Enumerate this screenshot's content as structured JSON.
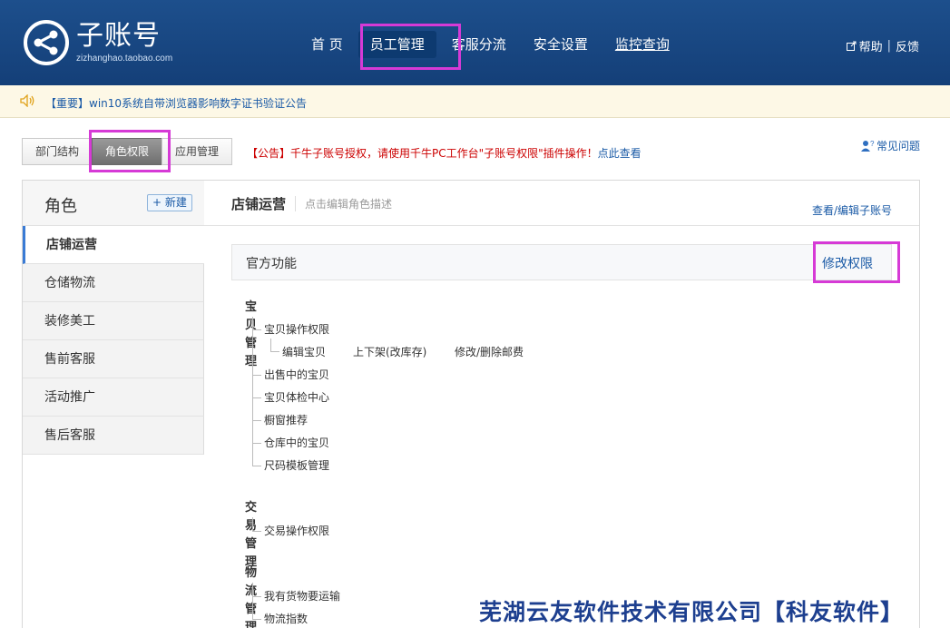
{
  "header": {
    "logo_title": "子账号",
    "logo_sub": "zizhanghao.taobao.com",
    "nav": [
      "首 页",
      "员工管理",
      "客服分流",
      "安全设置",
      "监控查询"
    ],
    "help": "帮助",
    "feedback": "反馈",
    "separator": "|"
  },
  "notice": {
    "text": "【重要】win10系统自带浏览器影响数字证书验证公告"
  },
  "tabs": [
    "部门结构",
    "角色权限",
    "应用管理"
  ],
  "announce": {
    "text": "【公告】千牛子账号授权，请使用千牛PC工作台\"子账号权限\"插件操作！",
    "link": "点此查看"
  },
  "faq": "常见问题",
  "sidebar": {
    "title": "角色",
    "new_button": "+ 新建",
    "roles": [
      "店铺运营",
      "仓储物流",
      "装修美工",
      "售前客服",
      "活动推广",
      "售后客服"
    ]
  },
  "content": {
    "role_name": "店铺运营",
    "role_desc": "点击编辑角色描述",
    "view_edit": "查看/编辑子账号",
    "func_title": "官方功能",
    "modify": "修改权限",
    "groups": [
      {
        "title": "宝贝管理",
        "items": [
          "宝贝操作权限",
          "出售中的宝贝",
          "宝贝体检中心",
          "橱窗推荐",
          "仓库中的宝贝",
          "尺码模板管理"
        ],
        "sub": [
          "编辑宝贝",
          "上下架(改库存)",
          "修改/删除邮费"
        ]
      },
      {
        "title": "交易管理",
        "items": [
          "交易操作权限"
        ]
      },
      {
        "title": "物流管理",
        "items": [
          "我有货物要运输",
          "物流指数"
        ]
      }
    ]
  },
  "watermark": "芜湖云友软件技术有限公司【科友软件】",
  "colors": {
    "header": "#1d4f8c",
    "link": "#1a5aa6",
    "highlight": "#d63ad6",
    "alert": "#cc0000"
  }
}
